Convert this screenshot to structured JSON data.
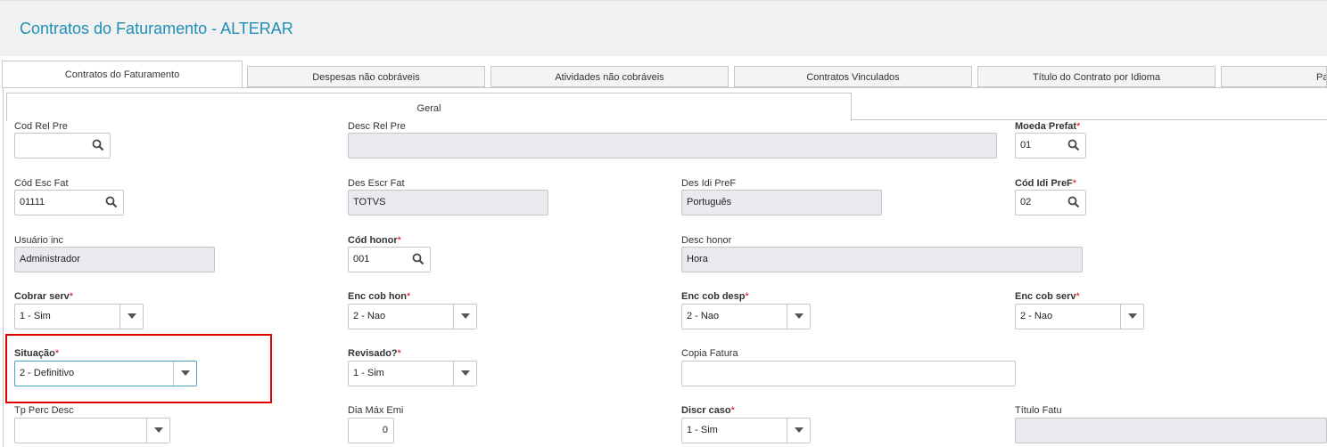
{
  "header": {
    "title": "Contratos do Faturamento - ALTERAR"
  },
  "tabs": [
    "Contratos do Faturamento",
    "Despesas não cobráveis",
    "Atividades não cobráveis",
    "Contratos Vinculados",
    "Título do Contrato por Idioma",
    "Pa"
  ],
  "subtab": {
    "label": "Geral"
  },
  "fields": {
    "cod_rel_pre": {
      "label": "Cod Rel Pre",
      "value": ""
    },
    "desc_rel_pre": {
      "label": "Desc Rel Pre",
      "value": ""
    },
    "moeda_prefat": {
      "label": "Moeda Prefat",
      "value": "01"
    },
    "cod_esc_fat": {
      "label": "Cód Esc Fat",
      "value": "01111"
    },
    "des_escr_fat": {
      "label": "Des Escr Fat",
      "value": "TOTVS"
    },
    "des_idi_pref": {
      "label": "Des Idi PreF",
      "value": "Português"
    },
    "cod_idi_pref": {
      "label": "Cód Idi PreF",
      "value": "02"
    },
    "usuario_inc": {
      "label": "Usuário inc",
      "value": "Administrador"
    },
    "cod_honor": {
      "label": "Cód honor",
      "value": "001"
    },
    "desc_honor": {
      "label": "Desc honor",
      "value": "Hora"
    },
    "cobrar_serv": {
      "label": "Cobrar serv",
      "value": "1 - Sim"
    },
    "enc_cob_hon": {
      "label": "Enc cob hon",
      "value": "2 - Nao"
    },
    "enc_cob_desp": {
      "label": "Enc cob desp",
      "value": "2 - Nao"
    },
    "enc_cob_serv": {
      "label": "Enc cob serv",
      "value": "2 - Nao"
    },
    "situacao": {
      "label": "Situação",
      "value": "2 - Definitivo"
    },
    "revisado": {
      "label": "Revisado?",
      "value": "1 - Sim"
    },
    "copia_fatura": {
      "label": "Copia Fatura",
      "value": ""
    },
    "tp_perc_desc": {
      "label": "Tp Perc Desc",
      "value": ""
    },
    "dia_max_emi": {
      "label": "Dia Máx Emi",
      "value": "0"
    },
    "discr_caso": {
      "label": "Discr caso",
      "value": "1 - Sim"
    },
    "titulo_fatu": {
      "label": "Título Fatu",
      "value": ""
    }
  },
  "required_marker": "*",
  "icons": {
    "lookup": "search-icon",
    "dropdown": "chevron-down-icon"
  },
  "colors": {
    "title": "#1e90b8",
    "required": "#e00000",
    "highlight": "#e00000",
    "readonly_bg": "#e9eaf0"
  }
}
